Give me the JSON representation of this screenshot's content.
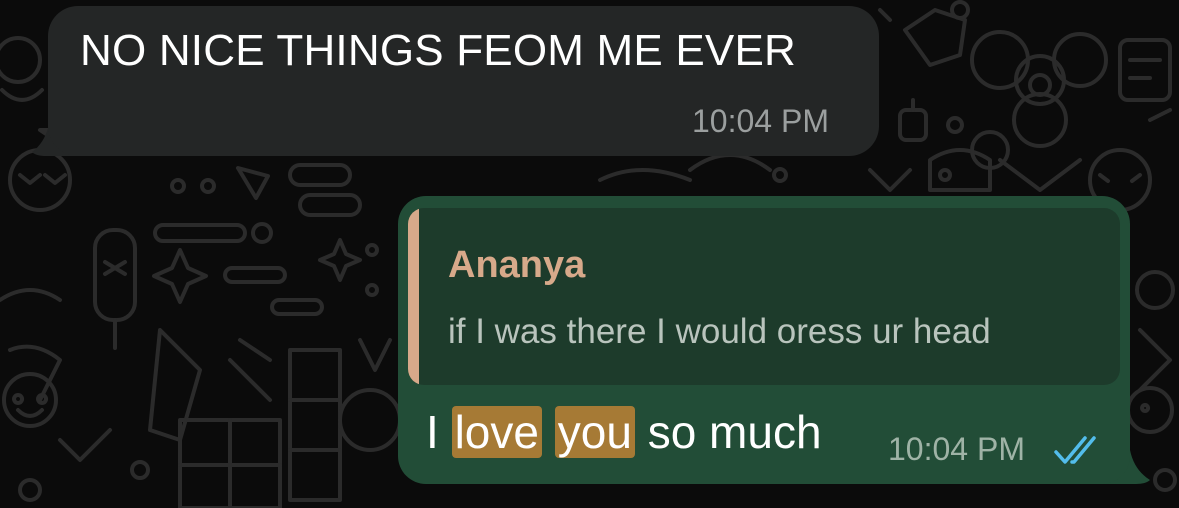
{
  "messages": [
    {
      "direction": "incoming",
      "text": "NO NICE THINGS FEOM ME EVER",
      "time": "10:04 PM"
    },
    {
      "direction": "outgoing",
      "reply_to": {
        "author": "Ananya",
        "text": "if I was there I would oress ur head"
      },
      "text_parts": [
        "I",
        "love",
        "you",
        "so much"
      ],
      "time": "10:04 PM",
      "status_icon": "double-check-read-icon"
    }
  ],
  "colors": {
    "background": "#0b0b0b",
    "incoming_bubble": "#242626",
    "outgoing_bubble": "#224d37",
    "quote_background": "#1d3b2b",
    "quote_accent": "#d7a98a",
    "highlight": "#a67a35",
    "read_ticks": "#53bdeb"
  }
}
